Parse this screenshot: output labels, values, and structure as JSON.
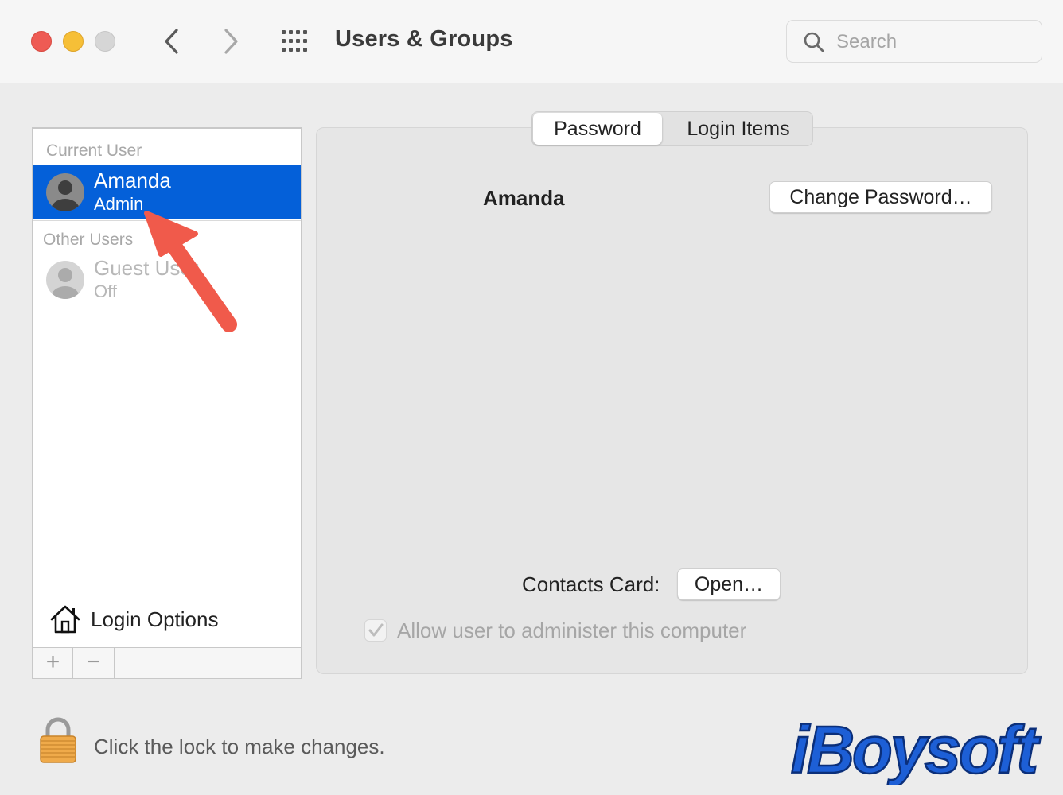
{
  "window": {
    "title": "Users & Groups",
    "search_placeholder": "Search"
  },
  "sidebar": {
    "current_user_label": "Current User",
    "current_user": {
      "name": "Amanda",
      "role": "Admin"
    },
    "other_users_label": "Other Users",
    "other_users": [
      {
        "name": "Guest User",
        "status": "Off"
      }
    ],
    "login_options_label": "Login Options",
    "add_symbol": "+",
    "remove_symbol": "−"
  },
  "tabs": [
    {
      "label": "Password",
      "active": true
    },
    {
      "label": "Login Items",
      "active": false
    }
  ],
  "main": {
    "account_name": "Amanda",
    "change_password_label": "Change Password…",
    "contacts_card_label": "Contacts Card:",
    "open_label": "Open…",
    "admin_checkbox_label": "Allow user to administer this computer",
    "admin_checkbox_checked": true
  },
  "footer": {
    "lock_message": "Click the lock to make changes.",
    "watermark": "iBoysoft"
  },
  "colors": {
    "selection": "#0460d9",
    "close": "#ee5b54",
    "minimize": "#f6bf37",
    "annotation_arrow": "#f05a4b",
    "watermark": "#1d5fd6"
  },
  "icons": [
    "chevron-left-icon",
    "chevron-right-icon",
    "grid-icon",
    "search-icon",
    "user-avatar-icon",
    "house-icon",
    "checkmark-icon",
    "lock-icon"
  ]
}
